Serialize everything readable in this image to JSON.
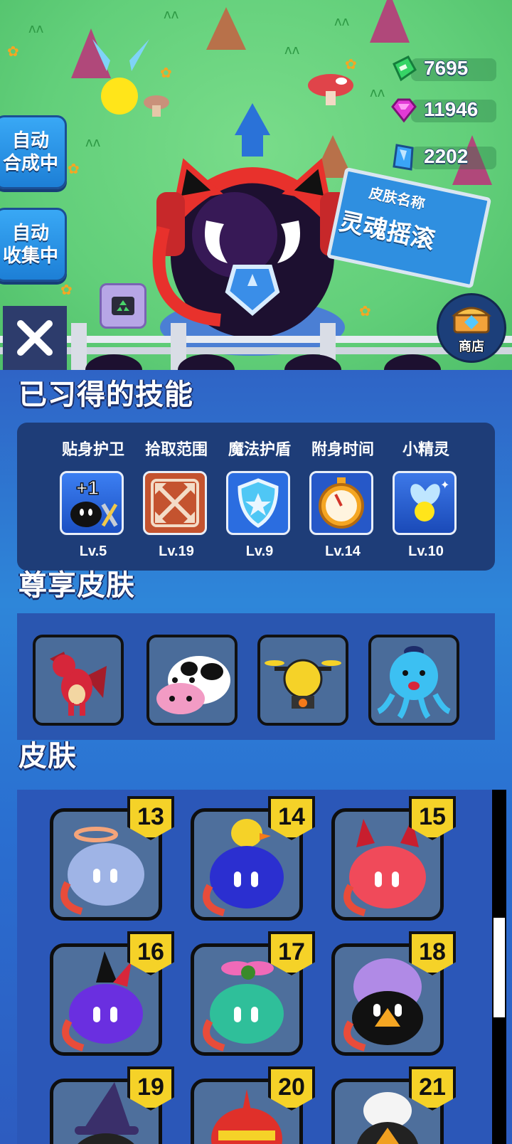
{
  "currencies": [
    {
      "icon": "green-cash-gem-icon",
      "value": "7695"
    },
    {
      "icon": "pink-gem-icon",
      "value": "11946"
    },
    {
      "icon": "blue-crystal-icon",
      "value": "2202"
    }
  ],
  "side_buttons": {
    "auto_merge": {
      "line1": "自动",
      "line2": "合成中"
    },
    "auto_collect": {
      "line1": "自动",
      "line2": "收集中"
    }
  },
  "billboard": {
    "heading": "皮肤名称",
    "name": "灵魂摇滚"
  },
  "shop": {
    "label": "商店"
  },
  "sections": {
    "skills_title": "已习得的技能",
    "premium_title": "尊享皮肤",
    "skins_title": "皮肤"
  },
  "skills": [
    {
      "name": "贴身护卫",
      "level": "Lv.5",
      "icon": "bodyguard-bomb-icon",
      "badge": "+1"
    },
    {
      "name": "拾取范围",
      "level": "Lv.19",
      "icon": "pickup-range-arrows-icon"
    },
    {
      "name": "魔法护盾",
      "level": "Lv.9",
      "icon": "magic-shield-icon"
    },
    {
      "name": "附身时间",
      "level": "Lv.14",
      "icon": "stopwatch-icon"
    },
    {
      "name": "小精灵",
      "level": "Lv.10",
      "icon": "fairy-icon"
    }
  ],
  "premium_skins": [
    {
      "icon": "red-dragon-icon"
    },
    {
      "icon": "cow-icon"
    },
    {
      "icon": "yellow-drone-icon"
    },
    {
      "icon": "blue-octopus-icon"
    }
  ],
  "skins": [
    {
      "number": "13",
      "icon": "angel-halo-slime-icon",
      "color": "#9fb4e6"
    },
    {
      "number": "14",
      "icon": "duck-hat-slime-icon",
      "color": "#2b2fd0"
    },
    {
      "number": "15",
      "icon": "devil-horn-slime-icon",
      "color": "#f04a5a"
    },
    {
      "number": "16",
      "icon": "jester-hat-slime-icon",
      "color": "#6a2fe0"
    },
    {
      "number": "17",
      "icon": "flower-slime-icon",
      "color": "#2fbf9a"
    },
    {
      "number": "18",
      "icon": "eggshell-penguin-slime-icon",
      "color": "#f5a623"
    },
    {
      "number": "19",
      "icon": "wizard-hat-slime-icon",
      "color": "#3a2f6a"
    },
    {
      "number": "20",
      "icon": "knight-helmet-slime-icon",
      "color": "#e0302a"
    },
    {
      "number": "21",
      "icon": "white-hair-slime-icon",
      "color": "#f0a020"
    }
  ],
  "colors": {
    "panel_blue": "#2e86d9",
    "box_dark": "#1e3d78",
    "badge_yellow": "#f5d228",
    "grass_green": "#62cf7a"
  }
}
